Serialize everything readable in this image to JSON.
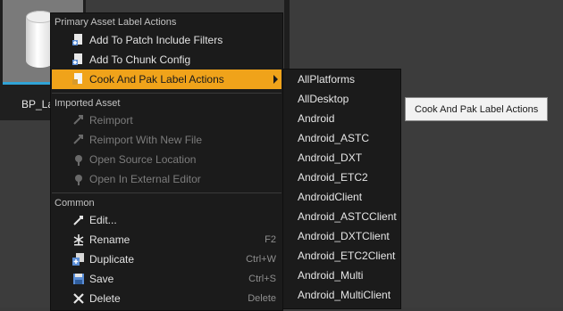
{
  "asset": {
    "label": "BP_La"
  },
  "menu": {
    "sections": [
      {
        "header": "Primary Asset Label Actions"
      },
      {
        "header": "Imported Asset"
      },
      {
        "header": "Common"
      }
    ],
    "primary_items": [
      {
        "label": "Add To Patch Include Filters",
        "icon": "patch-filter-icon"
      },
      {
        "label": "Add To Chunk Config",
        "icon": "chunk-config-icon"
      },
      {
        "label": "Cook And Pak Label Actions",
        "icon": "cook-pak-icon"
      }
    ],
    "imported_items": [
      {
        "label": "Reimport",
        "icon": "reimport-icon"
      },
      {
        "label": "Reimport With New File",
        "icon": "reimport-new-file-icon"
      },
      {
        "label": "Open Source Location",
        "icon": "open-source-location-icon"
      },
      {
        "label": "Open In External Editor",
        "icon": "external-editor-icon"
      }
    ],
    "common_items": [
      {
        "label": "Edit...",
        "shortcut": "",
        "icon": "edit-icon"
      },
      {
        "label": "Rename",
        "shortcut": "F2",
        "icon": "rename-icon"
      },
      {
        "label": "Duplicate",
        "shortcut": "Ctrl+W",
        "icon": "duplicate-icon"
      },
      {
        "label": "Save",
        "shortcut": "Ctrl+S",
        "icon": "save-icon"
      },
      {
        "label": "Delete",
        "shortcut": "Delete",
        "icon": "delete-icon"
      }
    ]
  },
  "submenu": {
    "items": [
      "AllPlatforms",
      "AllDesktop",
      "Android",
      "Android_ASTC",
      "Android_DXT",
      "Android_ETC2",
      "AndroidClient",
      "Android_ASTCClient",
      "Android_DXTClient",
      "Android_ETC2Client",
      "Android_Multi",
      "Android_MultiClient"
    ]
  },
  "tooltip": {
    "text": "Cook And Pak Label Actions"
  },
  "colors": {
    "highlight": "#f0a31a",
    "menu_bg": "#1b1b1b",
    "selection_border": "#30a3d6"
  }
}
